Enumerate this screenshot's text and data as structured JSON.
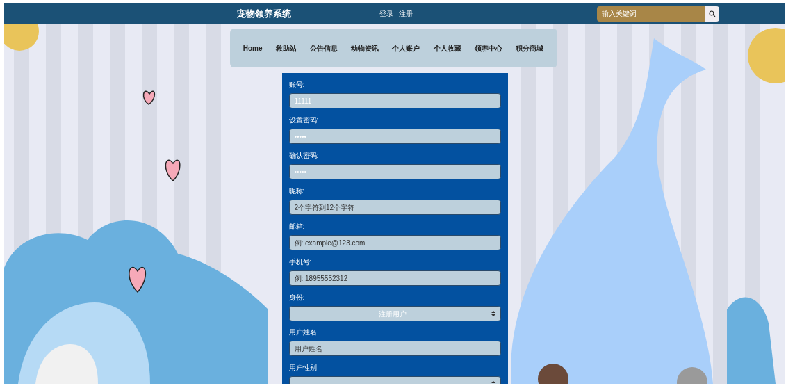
{
  "header": {
    "title": "宠物领养系统",
    "links": [
      "登录",
      "注册"
    ],
    "search": {
      "placeholder": "输入关键词"
    }
  },
  "nav": {
    "items": [
      {
        "label": "Home",
        "selected": false
      },
      {
        "label": "救助站",
        "selected": false
      },
      {
        "label": "公告信息",
        "selected": false
      },
      {
        "label": "动物资讯",
        "selected": false
      },
      {
        "label": "个人账户",
        "selected": false
      },
      {
        "label": "个人收藏",
        "selected": false
      },
      {
        "label": "领养中心",
        "selected": false
      },
      {
        "label": "积分商城",
        "selected": false
      }
    ]
  },
  "form": {
    "fields": [
      {
        "kind": "text",
        "label": "账号:",
        "value": "11111"
      },
      {
        "kind": "text",
        "label": "设置密码:",
        "value": "•••••"
      },
      {
        "kind": "text",
        "label": "确认密码:",
        "value": "•••••"
      },
      {
        "kind": "text",
        "label": "昵称:",
        "placeholder": "2个字符到12个字符"
      },
      {
        "kind": "text",
        "label": "邮箱:",
        "placeholder": "例: example@123.com"
      },
      {
        "kind": "text",
        "label": "手机号:",
        "placeholder": "例: 18955552312"
      },
      {
        "kind": "select",
        "label": "身份:",
        "value": "注册用户"
      },
      {
        "kind": "text",
        "label": "用户姓名",
        "placeholder": "用户姓名"
      },
      {
        "kind": "select",
        "label": "用户性别"
      }
    ]
  }
}
